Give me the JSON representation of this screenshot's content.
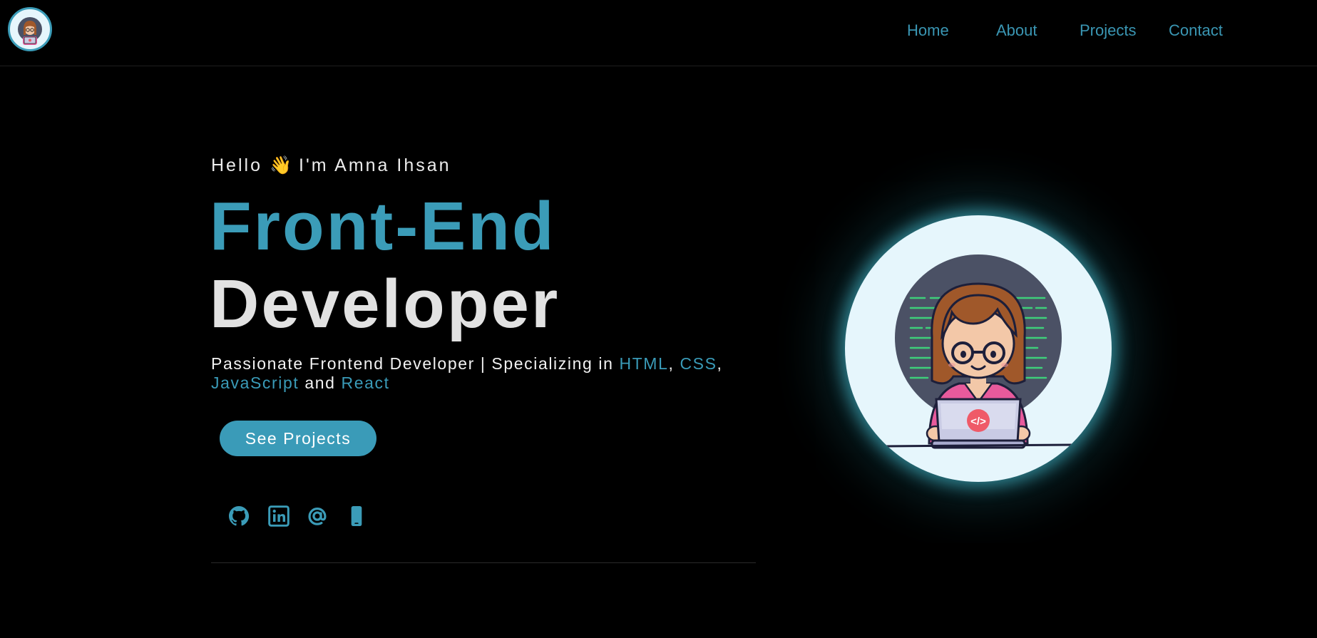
{
  "header": {
    "nav": [
      {
        "label": "Home"
      },
      {
        "label": "About"
      },
      {
        "label": "Projects"
      },
      {
        "label": "Contact"
      }
    ]
  },
  "hero": {
    "greeting": "Hello",
    "wave_emoji": "👋",
    "intro": "I'm Amna Ihsan",
    "title_line1": "Front-End",
    "title_line2": "Developer",
    "tagline_prefix": "Passionate Frontend Developer | Specializing in ",
    "tech": [
      "HTML",
      "CSS",
      "JavaScript",
      "React"
    ],
    "sep_comma": ", ",
    "sep_trailing": ",",
    "sep_and": " and ",
    "cta_label": "See Projects"
  },
  "social_icons": [
    "github-icon",
    "linkedin-icon",
    "email-icon",
    "phone-icon"
  ],
  "avatar": {
    "code_badge": "</>"
  },
  "colors": {
    "accent": "#3b9cb8",
    "background": "#000000",
    "title_light": "#e2e2e2",
    "avatar_bg": "#e6f6fc"
  }
}
